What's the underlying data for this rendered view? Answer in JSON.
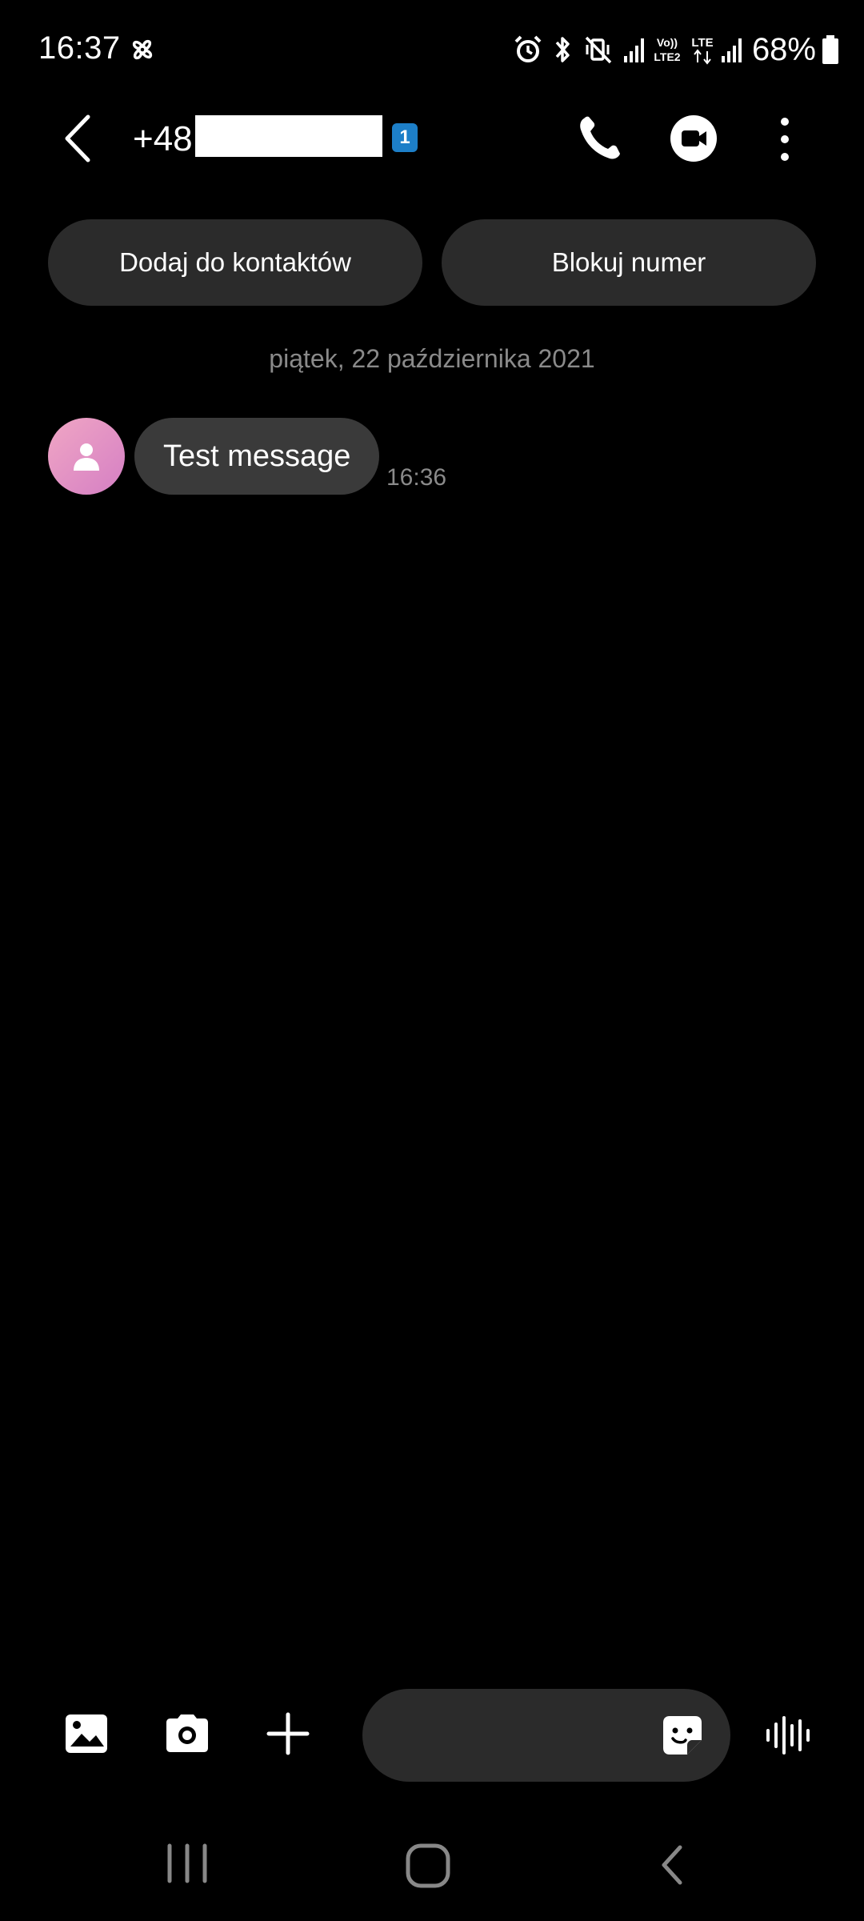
{
  "status_bar": {
    "time": "16:37",
    "battery": "68%",
    "icons": [
      "fan-icon",
      "alarm-icon",
      "bluetooth-icon",
      "vibrate-off-icon",
      "signal-icon",
      "volte-lte2-icon",
      "lte-icon",
      "signal-icon",
      "battery-icon"
    ],
    "volte_label": "Vo)) LTE2",
    "lte_label": "LTE"
  },
  "header": {
    "contact_number": "+48",
    "sim_badge": "1"
  },
  "actions": {
    "add_contact_label": "Dodaj do kontaktów",
    "block_number_label": "Blokuj numer"
  },
  "conversation": {
    "date_separator": "piątek, 22 października 2021",
    "messages": [
      {
        "text": "Test message",
        "time": "16:36",
        "direction": "incoming"
      }
    ]
  },
  "composer": {
    "placeholder": ""
  },
  "colors": {
    "background": "#000000",
    "pill": "#2b2b2b",
    "bubble_incoming": "#3a3a3a",
    "secondary_text": "#8a8a8a",
    "sim_badge": "#1d7fc8",
    "avatar_gradient_start": "#f0a6c4",
    "avatar_gradient_end": "#d57fc4"
  }
}
